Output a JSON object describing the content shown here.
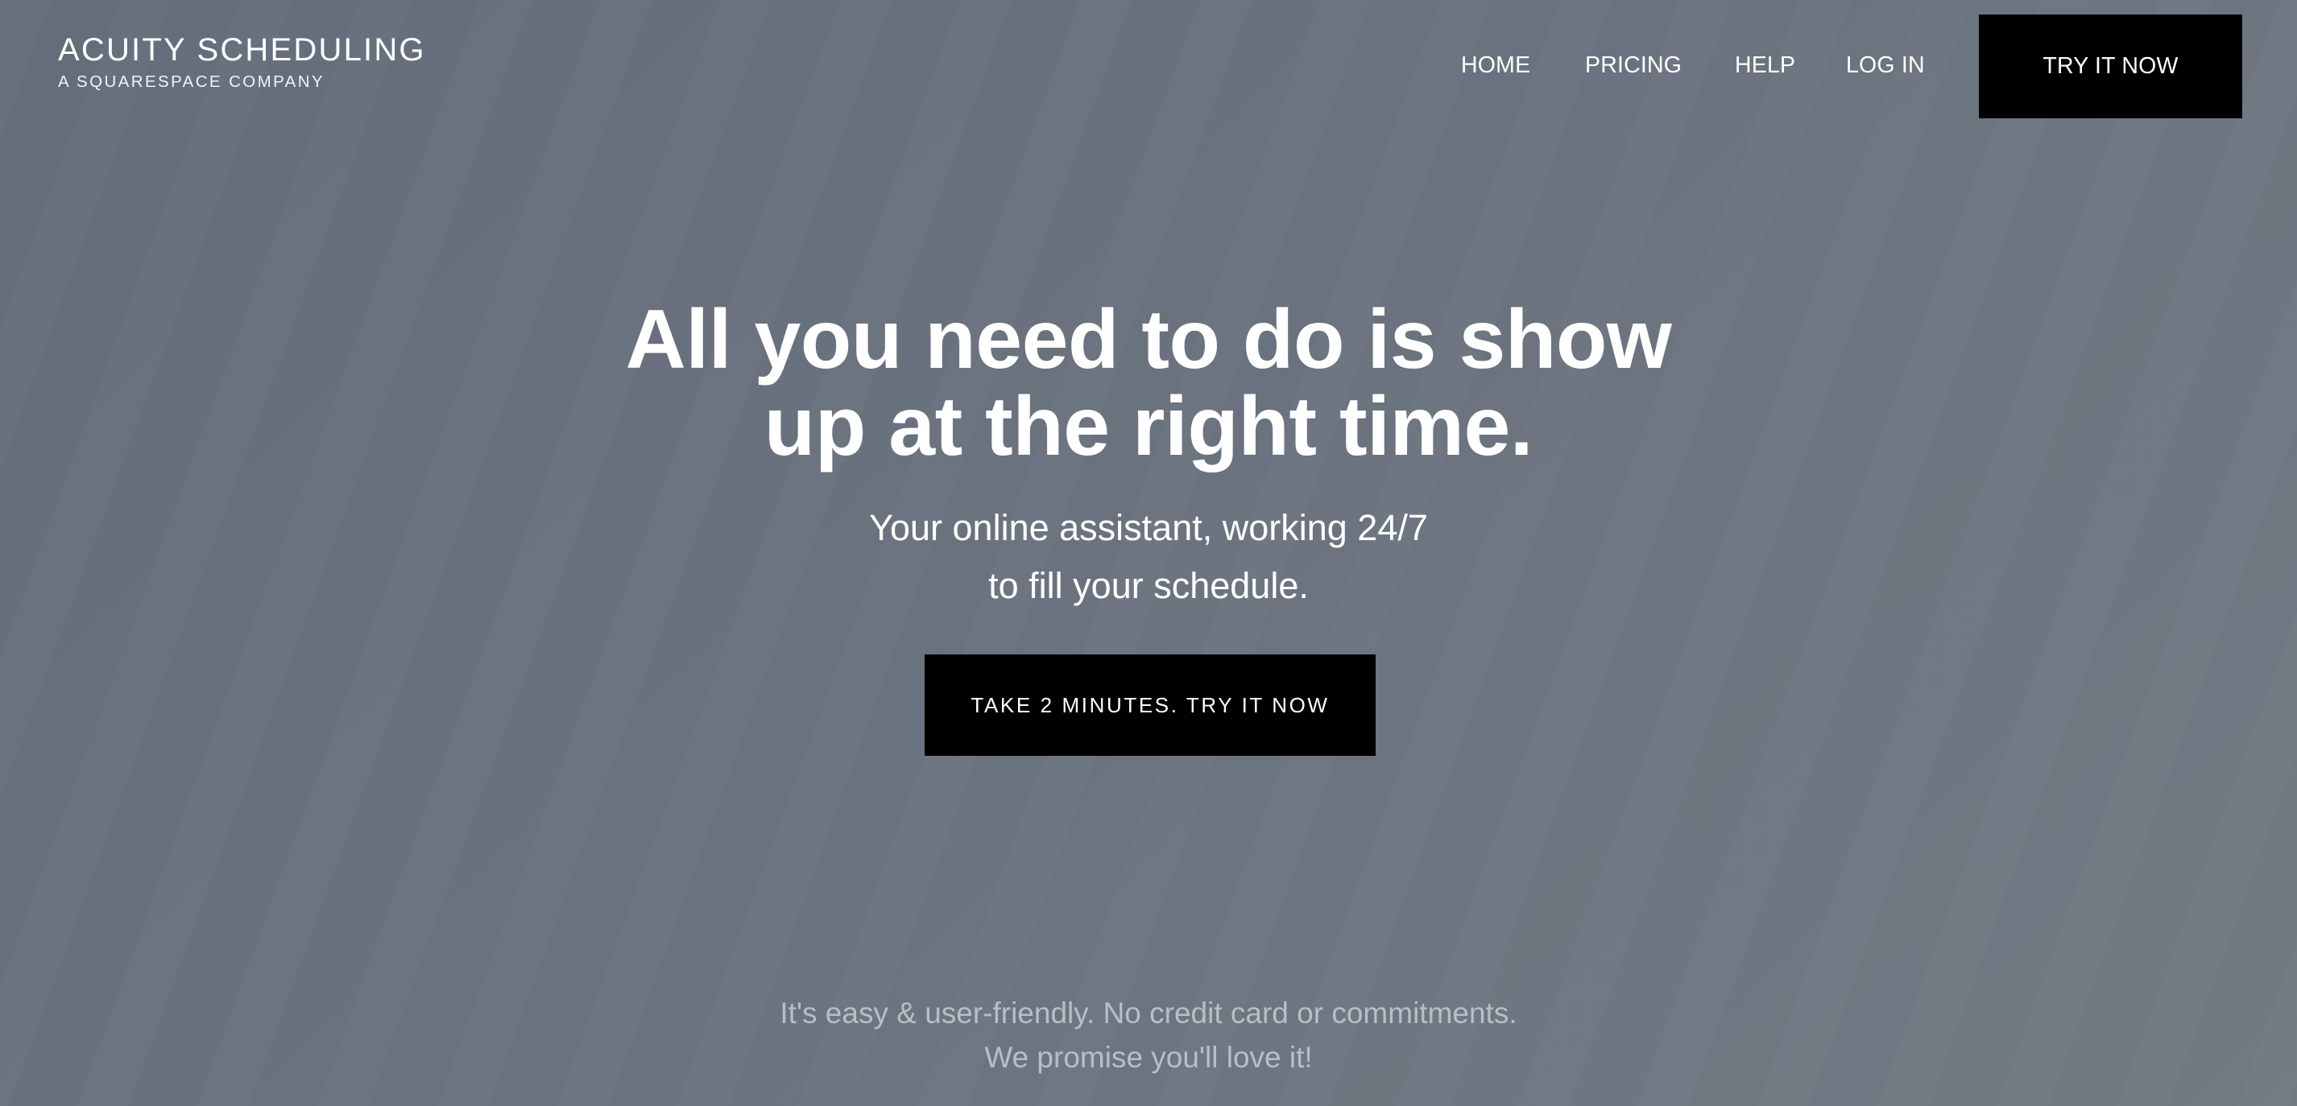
{
  "brand": {
    "title": "ACUITY SCHEDULING",
    "subtitle": "A SQUARESPACE COMPANY"
  },
  "nav": {
    "items": [
      {
        "label": "HOME"
      },
      {
        "label": "PRICING"
      },
      {
        "label": "HELP"
      },
      {
        "label": "LOG IN"
      }
    ],
    "cta_label": "TRY IT NOW"
  },
  "hero": {
    "title_line1": "All you need to do is show",
    "title_line2": "up at the right time.",
    "subtitle_line1": "Your online assistant, working 24/7",
    "subtitle_line2": "to fill your schedule.",
    "cta_label": "TAKE 2 MINUTES. TRY IT NOW"
  },
  "footer_note": {
    "line1": "It's easy & user-friendly. No credit card or commitments.",
    "line2": "We promise you'll love it!"
  },
  "colors": {
    "background": "#6b7380",
    "button_bg": "#000000",
    "text": "#ffffff",
    "muted_text": "#b9bec6"
  }
}
